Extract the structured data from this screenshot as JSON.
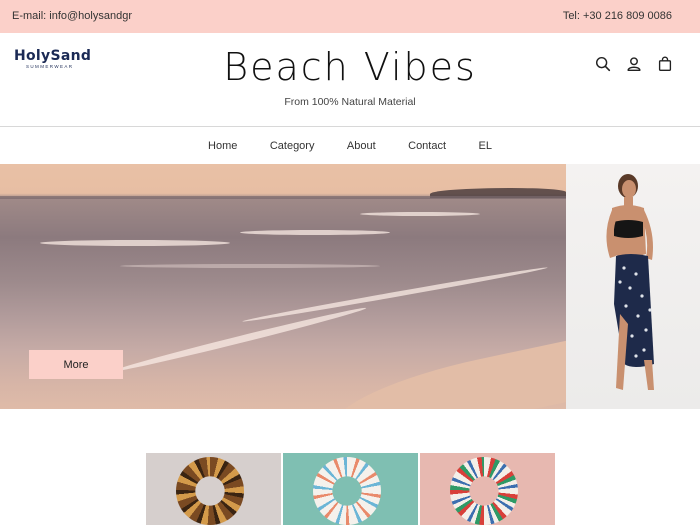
{
  "topbar": {
    "email": "E-mail: info@holysandgr",
    "phone": "Tel: +30 216 809 0086"
  },
  "header": {
    "logo_text": "HolySand",
    "logo_sub": "SUMMERWEAR",
    "title": "Beach Vibes",
    "tagline": "From 100% Natural Material",
    "icons": [
      "search-icon",
      "account-icon",
      "cart-icon"
    ]
  },
  "nav": {
    "items": [
      "Home",
      "Category",
      "About",
      "Contact",
      "EL"
    ]
  },
  "hero": {
    "button_label": "More"
  },
  "colors": {
    "accent": "#fbd0c9",
    "navy": "#1b2a55"
  }
}
